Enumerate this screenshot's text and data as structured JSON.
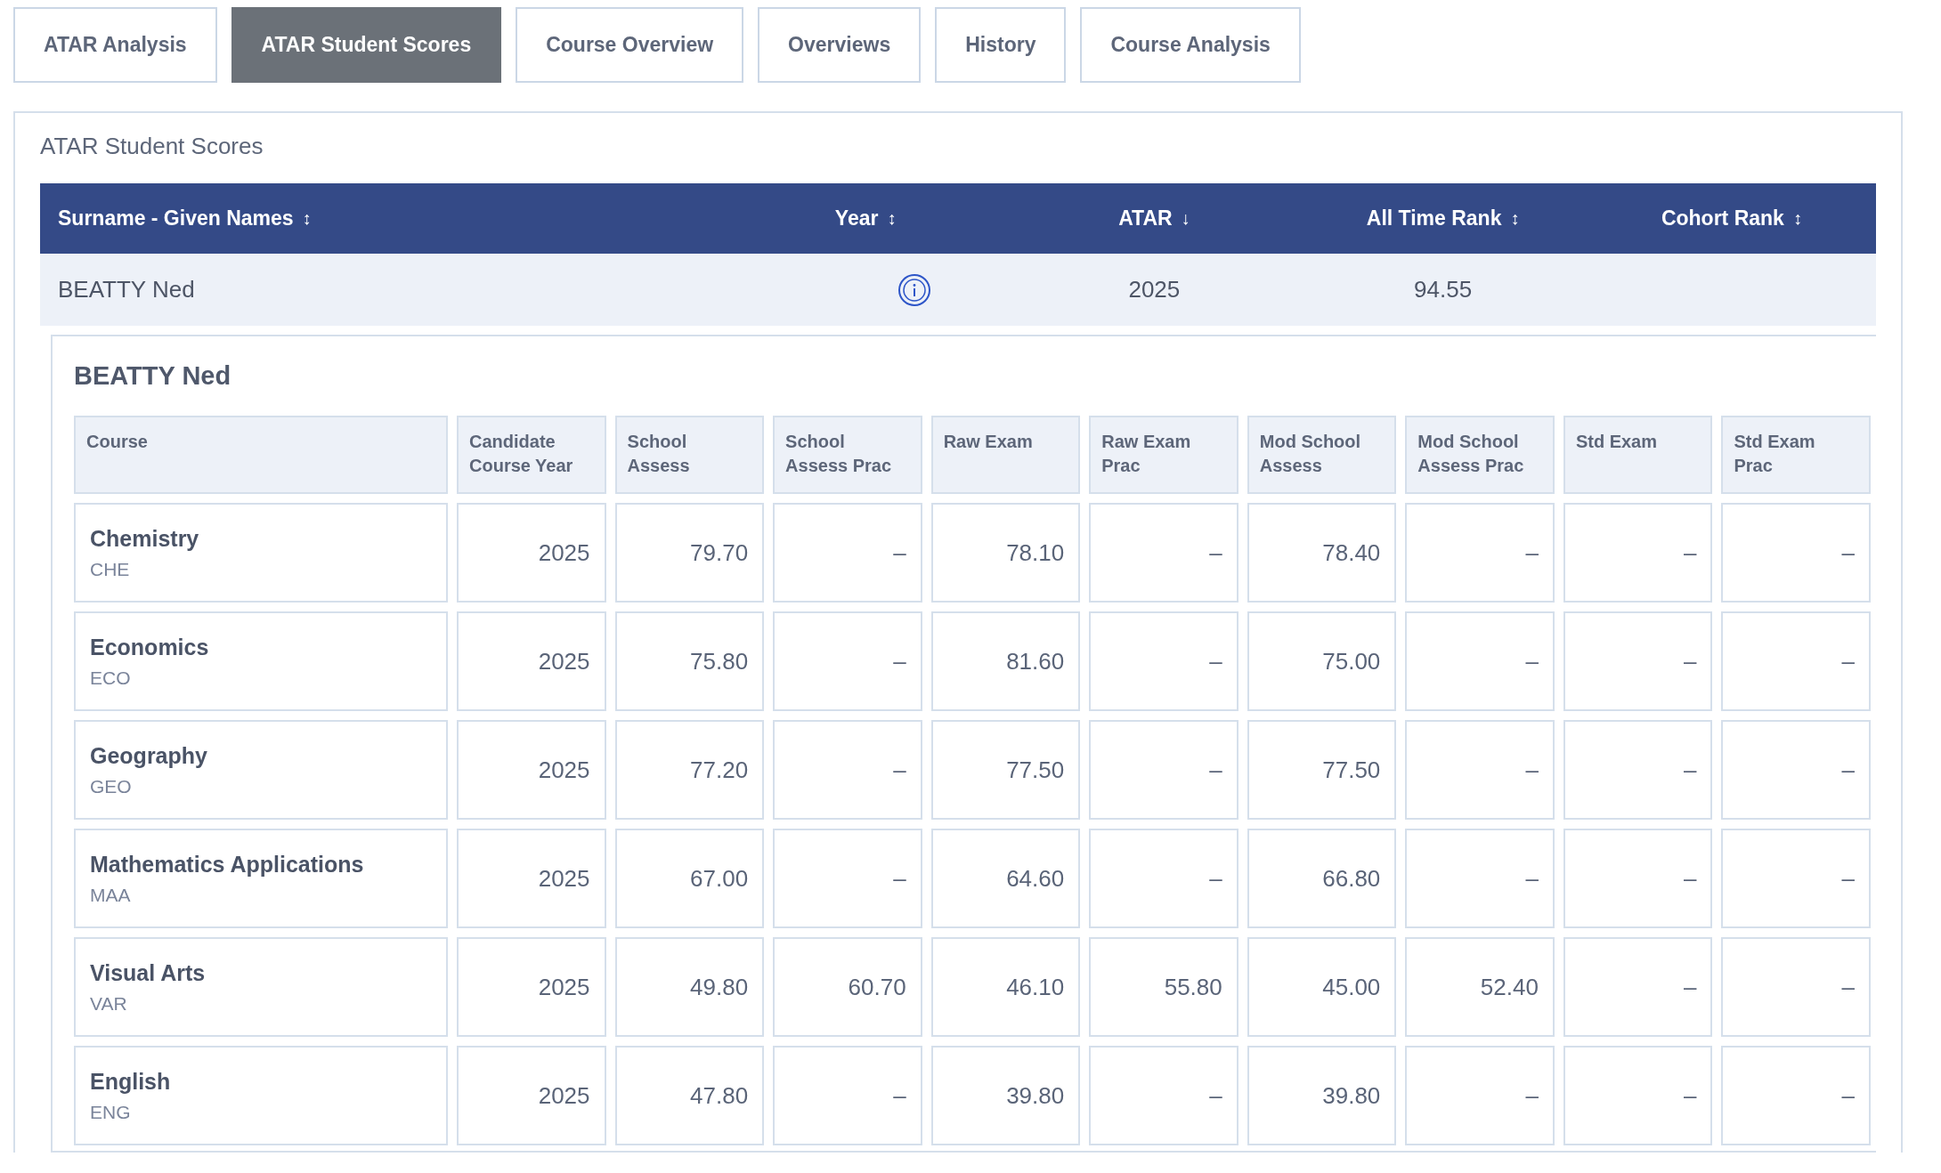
{
  "tabs": [
    {
      "label": "ATAR Analysis",
      "selected": false
    },
    {
      "label": "ATAR Student Scores",
      "selected": true
    },
    {
      "label": "Course Overview",
      "selected": false
    },
    {
      "label": "Overviews",
      "selected": false
    },
    {
      "label": "History",
      "selected": false
    },
    {
      "label": "Course Analysis",
      "selected": false
    }
  ],
  "panel": {
    "title": "ATAR Student Scores",
    "table": {
      "columns": [
        {
          "label": "Surname - Given Names",
          "sort": "↕"
        },
        {
          "label": "Year",
          "sort": "↕"
        },
        {
          "label": "ATAR",
          "sort": "↓"
        },
        {
          "label": "All Time Rank",
          "sort": "↕"
        },
        {
          "label": "Cohort Rank",
          "sort": "↕"
        }
      ],
      "rows": [
        {
          "name": "BEATTY Ned",
          "info": true,
          "cell_3": "2025",
          "cell_4": "94.55",
          "expanded": true,
          "detail": {
            "title": "BEATTY Ned",
            "columns": [
              "Course",
              "Candidate Course Year",
              "School Assess",
              "School Assess Prac",
              "Raw Exam",
              "Raw Exam Prac",
              "Mod School Assess",
              "Mod School Assess Prac",
              "Std Exam",
              "Std Exam Prac"
            ],
            "courses": [
              {
                "name": "Chemistry",
                "code": "CHE",
                "values": [
                  "2025",
                  "79.70",
                  "–",
                  "78.10",
                  "–",
                  "78.40",
                  "–",
                  "–",
                  "–"
                ]
              },
              {
                "name": "Economics",
                "code": "ECO",
                "values": [
                  "2025",
                  "75.80",
                  "–",
                  "81.60",
                  "–",
                  "75.00",
                  "–",
                  "–",
                  "–"
                ]
              },
              {
                "name": "Geography",
                "code": "GEO",
                "values": [
                  "2025",
                  "77.20",
                  "–",
                  "77.50",
                  "–",
                  "77.50",
                  "–",
                  "–",
                  "–"
                ]
              },
              {
                "name": "Mathematics Applications",
                "code": "MAA",
                "values": [
                  "2025",
                  "67.00",
                  "–",
                  "64.60",
                  "–",
                  "66.80",
                  "–",
                  "–",
                  "–"
                ]
              },
              {
                "name": "Visual Arts",
                "code": "VAR",
                "values": [
                  "2025",
                  "49.80",
                  "60.70",
                  "46.10",
                  "55.80",
                  "45.00",
                  "52.40",
                  "–",
                  "–"
                ]
              },
              {
                "name": "English",
                "code": "ENG",
                "values": [
                  "2025",
                  "47.80",
                  "–",
                  "39.80",
                  "–",
                  "39.80",
                  "–",
                  "–",
                  "–"
                ]
              }
            ]
          }
        }
      ]
    }
  }
}
